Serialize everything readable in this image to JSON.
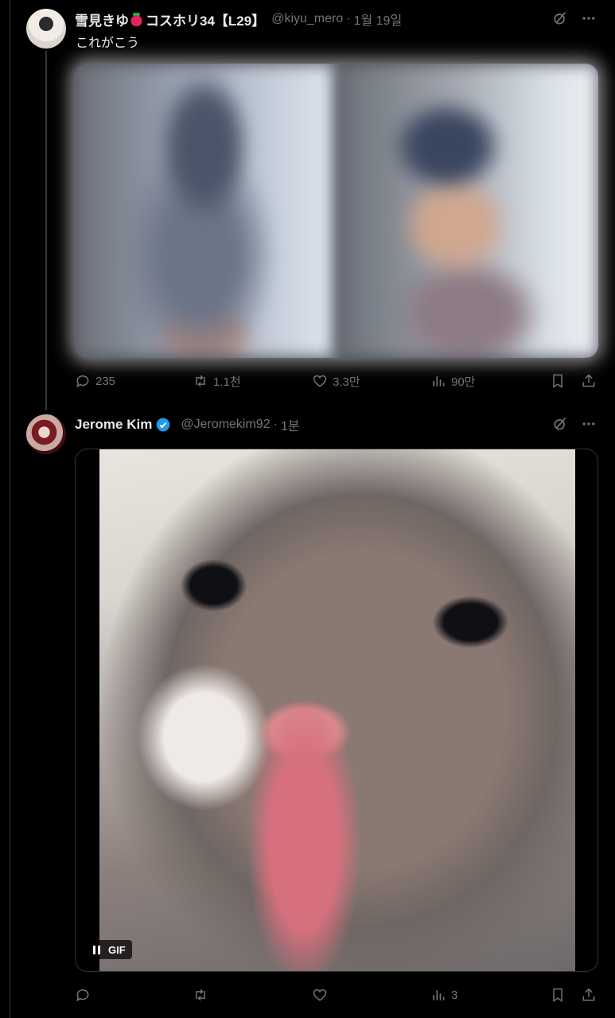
{
  "tweets": [
    {
      "display_name": "雪見きゆ",
      "name_suffix": "コスホリ34【L29】",
      "handle": "@kiyu_mero",
      "time": "1월 19일",
      "text": "これがこう",
      "stats": {
        "replies": "235",
        "retweets": "1.1천",
        "likes": "3.3만",
        "views": "90만"
      }
    },
    {
      "display_name": "Jerome Kim",
      "handle": "@Jeromekim92",
      "time": "1분",
      "gif_badge": "GIF",
      "stats": {
        "replies": "",
        "retweets": "",
        "likes": "",
        "views": "3"
      }
    }
  ],
  "icons": {
    "grok": "grok-icon",
    "more": "more-icon",
    "reply": "reply-icon",
    "retweet": "retweet-icon",
    "like": "heart-icon",
    "views": "views-icon",
    "bookmark": "bookmark-icon",
    "share": "share-icon",
    "verified": "verified-badge-icon"
  },
  "colors": {
    "background": "#000000",
    "text": "#e7e9ea",
    "muted": "#71767b",
    "verified": "#1d9bf0"
  }
}
